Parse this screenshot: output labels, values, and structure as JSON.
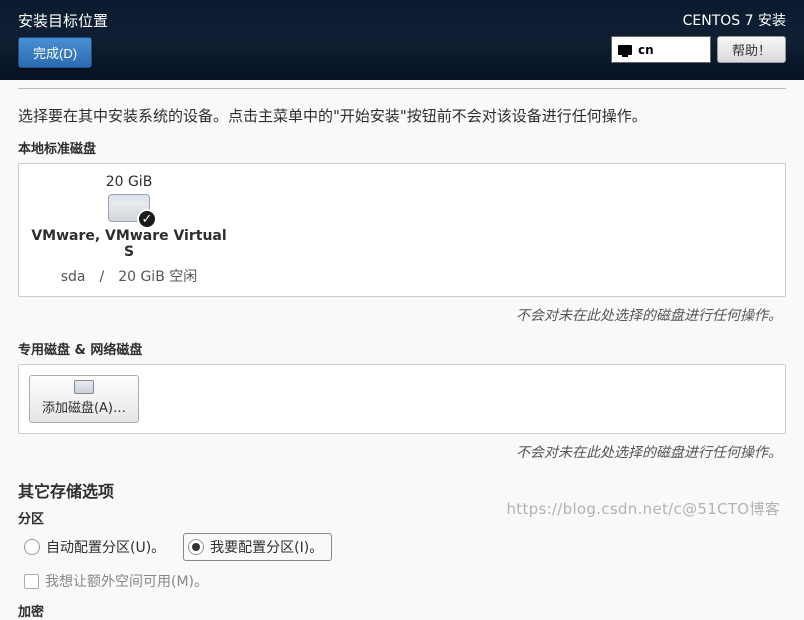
{
  "header": {
    "title": "安装目标位置",
    "done_button": "完成(D)",
    "subtitle": "CENTOS 7 安装",
    "keyboard_layout": "cn",
    "help_button": "帮助！"
  },
  "info_line": "选择要在其中安装系统的设备。点击主菜单中的\"开始安装\"按钮前不会对该设备进行任何操作。",
  "sections": {
    "local_disks_label": "本地标准磁盘",
    "specialized_label": "专用磁盘 & 网络磁盘",
    "note_text": "不会对未在此处选择的磁盘进行任何操作。"
  },
  "disk": {
    "size": "20 GiB",
    "name": "VMware, VMware Virtual S",
    "detail": "sda　/　20 GiB 空闲",
    "selected": true
  },
  "add_disk_label": "添加磁盘(A)…",
  "storage_options": {
    "heading": "其它存储选项",
    "partition_label": "分区",
    "auto_partition": "自动配置分区(U)。",
    "manual_partition": "我要配置分区(I)。",
    "selected_partition": "manual",
    "extra_space": "我想让额外空间可用(M)。",
    "encryption_label": "加密"
  },
  "watermark": "https://blog.csdn.net/c@51CTO博客"
}
